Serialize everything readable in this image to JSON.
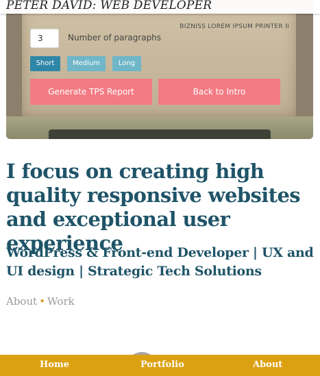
{
  "header": {
    "site_title": "PETER DAVID: WEB DEVELOPER"
  },
  "hero": {
    "printer_label": "BIZNISS LOREM IPSUM PRINTER II",
    "paragraphs_value": "3",
    "paragraphs_label": "Number of paragraphs",
    "length_buttons": [
      "Short",
      "Medium",
      "Long"
    ],
    "generate_label": "Generate TPS Report",
    "intro_label": "Back to Intro"
  },
  "main": {
    "headline": "I focus on creating high quality responsive websites and exceptional user experience",
    "subhead": "WordPress & Front-end Developer | UX and UI design | Strategic Tech Solutions",
    "links": {
      "about": "About",
      "separator": "•",
      "work": "Work"
    }
  },
  "bottom_nav": {
    "home": "Home",
    "portfolio": "Portfolio",
    "about": "About"
  },
  "colors": {
    "accent_teal": "#1f5468",
    "button_blue": "#2f87a8",
    "button_pink": "#f37b83",
    "nav_gold": "#dca112"
  }
}
